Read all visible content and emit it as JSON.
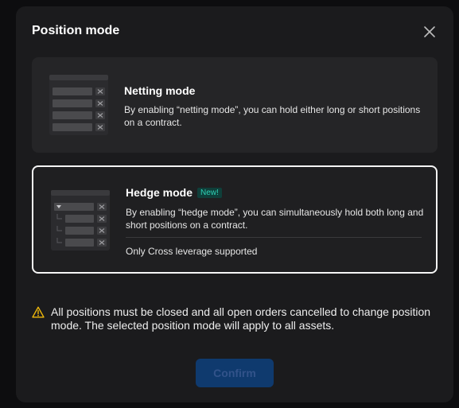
{
  "dialog": {
    "title": "Position mode",
    "close_icon": "close-icon"
  },
  "options": {
    "netting": {
      "title": "Netting mode",
      "description": "By enabling “netting mode”, you can hold either long or short positions on a contract.",
      "selected": false
    },
    "hedge": {
      "title": "Hedge mode",
      "badge": "New!",
      "description": "By enabling “hedge mode”, you can simultaneously hold both long and short positions on a contract.",
      "note": "Only Cross leverage supported",
      "selected": true
    }
  },
  "warning": {
    "icon": "warning-icon",
    "text": "All positions must be closed and all open orders cancelled to change position mode. The selected position mode will apply to all assets."
  },
  "confirm_label": "Confirm",
  "colors": {
    "accent_badge": "#2ed3b7",
    "warning": "#f0b90b",
    "confirm_disabled_bg": "#0f3a6e"
  }
}
